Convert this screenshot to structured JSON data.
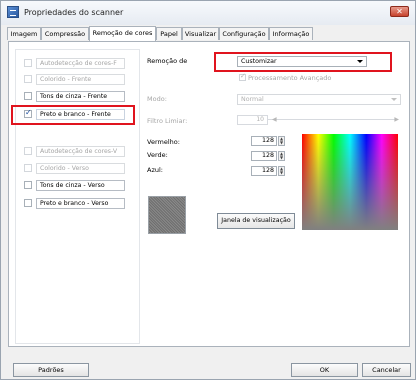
{
  "window": {
    "title": "Propriedades do scanner",
    "close_glyph": "✕"
  },
  "tabs": [
    {
      "label": "Imagem",
      "active": false
    },
    {
      "label": "Compressão",
      "active": false
    },
    {
      "label": "Remoção de cores",
      "active": true
    },
    {
      "label": "Papel",
      "active": false
    },
    {
      "label": "Visualizar",
      "active": false
    },
    {
      "label": "Configuração",
      "active": false
    },
    {
      "label": "Informação",
      "active": false
    }
  ],
  "image_options": [
    {
      "label": "Autodetecção de cores-F",
      "checked": false,
      "enabled": false
    },
    {
      "label": "Colorido - Frente",
      "checked": false,
      "enabled": false
    },
    {
      "label": "Tons de cinza - Frente",
      "checked": false,
      "enabled": true
    },
    {
      "label": "Preto e branco - Frente",
      "checked": true,
      "enabled": true
    },
    {
      "label": "Autodetecção de cores-V",
      "checked": false,
      "enabled": false
    },
    {
      "label": "Colorido - Verso",
      "checked": false,
      "enabled": false
    },
    {
      "label": "Tons de cinza - Verso",
      "checked": false,
      "enabled": true
    },
    {
      "label": "Preto e branco - Verso",
      "checked": false,
      "enabled": true
    }
  ],
  "settings": {
    "remocao_label": "Remoção de",
    "remocao_value": "Customizar",
    "processamento_label": "Processamento Avançado",
    "modo_label": "Modo:",
    "modo_value": "Normal",
    "filtro_label": "Filtro Limiar:",
    "filtro_value": "10",
    "vermelho_label": "Vermelho:",
    "vermelho_value": "128",
    "verde_label": "Verde:",
    "verde_value": "128",
    "azul_label": "Azul:",
    "azul_value": "128",
    "preview_button": "Janela de visualização"
  },
  "footer": {
    "padroes": "Padrões",
    "ok": "OK",
    "cancelar": "Cancelar"
  },
  "colors": {
    "highlight": "#e0141e",
    "swatch_gray": "#7f7f7f"
  }
}
